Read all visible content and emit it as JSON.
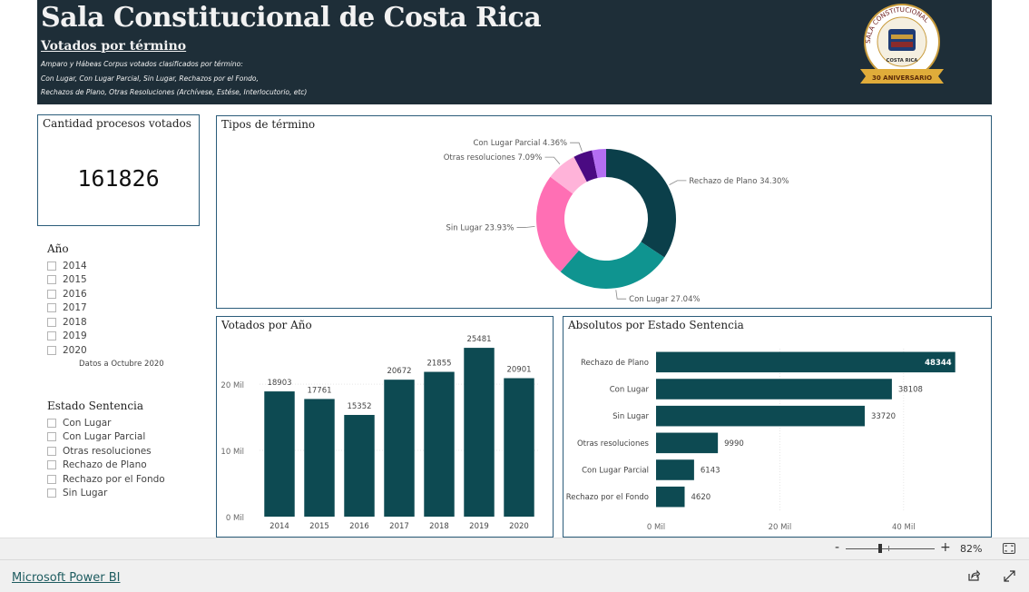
{
  "header": {
    "title": "Sala Constitucional de Costa Rica",
    "subtitle": "Votados por término",
    "desc": [
      "Amparo y Hábeas Corpus votados clasificados por término:",
      "Con Lugar, Con Lugar Parcial, Sin Lugar, Rechazos por el Fondo,",
      "Rechazos de Plano, Otras Resoluciones (Archívese, Estése, Interlocutorio, etc)"
    ],
    "logo": {
      "icon": "sala-constitucional-seal",
      "ring_text": "SALA CONSTITUCIONAL",
      "bottom_text": "COSTA RICA",
      "ribbon_text": "30 ANIVERSARIO"
    }
  },
  "kpi": {
    "title": "Cantidad procesos votados",
    "value": "161826"
  },
  "year_slicer": {
    "title": "Año",
    "items": [
      "2014",
      "2015",
      "2016",
      "2017",
      "2018",
      "2019",
      "2020"
    ],
    "note": "Datos a Octubre 2020"
  },
  "estado_slicer": {
    "title": "Estado Sentencia",
    "items": [
      "Con Lugar",
      "Con Lugar Parcial",
      "Otras resoluciones",
      "Rechazo de Plano",
      "Rechazo por el Fondo",
      "Sin Lugar"
    ]
  },
  "colors": {
    "header_bg": "#1e2e38",
    "bar": "#0d4a52",
    "border": "#2b5c7a"
  },
  "chart_data": [
    {
      "type": "pie",
      "title": "Tipos de término",
      "labels": [
        "Rechazo de Plano",
        "Con Lugar",
        "Sin Lugar",
        "Otras resoluciones",
        "Con Lugar Parcial",
        ""
      ],
      "values": [
        34.3,
        27.04,
        23.93,
        7.09,
        4.36,
        3.28
      ],
      "display_labels": [
        "Rechazo de Plano 34.30%",
        "Con Lugar 27.04%",
        "Sin Lugar 23.93%",
        "Otras resoluciones 7.09%",
        "Con Lugar Parcial 4.36%",
        ""
      ],
      "colors": [
        "#0b3f4a",
        "#0f9490",
        "#ff6fb4",
        "#ffb3d9",
        "#4a0a82",
        "#b46ef2"
      ],
      "donut": true
    },
    {
      "type": "bar",
      "title": "Votados por Año",
      "categories": [
        "2014",
        "2015",
        "2016",
        "2017",
        "2018",
        "2019",
        "2020"
      ],
      "values": [
        18903,
        17761,
        15352,
        20672,
        21855,
        25481,
        20901
      ],
      "yticks": [
        {
          "value": 0,
          "label": "0 Mil"
        },
        {
          "value": 10000,
          "label": "10 Mil"
        },
        {
          "value": 20000,
          "label": "20 Mil"
        }
      ],
      "ylim": [
        0,
        27000
      ],
      "grid": true
    },
    {
      "type": "bar",
      "orientation": "horizontal",
      "title": "Absolutos por Estado Sentencia",
      "categories": [
        "Rechazo de Plano",
        "Con Lugar",
        "Sin Lugar",
        "Otras resoluciones",
        "Con Lugar Parcial",
        "Rechazo por el Fondo"
      ],
      "values": [
        48344,
        38108,
        33720,
        9990,
        6143,
        4620
      ],
      "xticks": [
        {
          "value": 0,
          "label": "0 Mil"
        },
        {
          "value": 20000,
          "label": "20 Mil"
        },
        {
          "value": 40000,
          "label": "40 Mil"
        }
      ],
      "xlim": [
        0,
        50000
      ],
      "grid": true
    }
  ],
  "statusbar": {
    "zoom_minus": "-",
    "zoom_plus": "+",
    "zoom_value": "82%"
  },
  "footer": {
    "link": "Microsoft Power BI"
  }
}
